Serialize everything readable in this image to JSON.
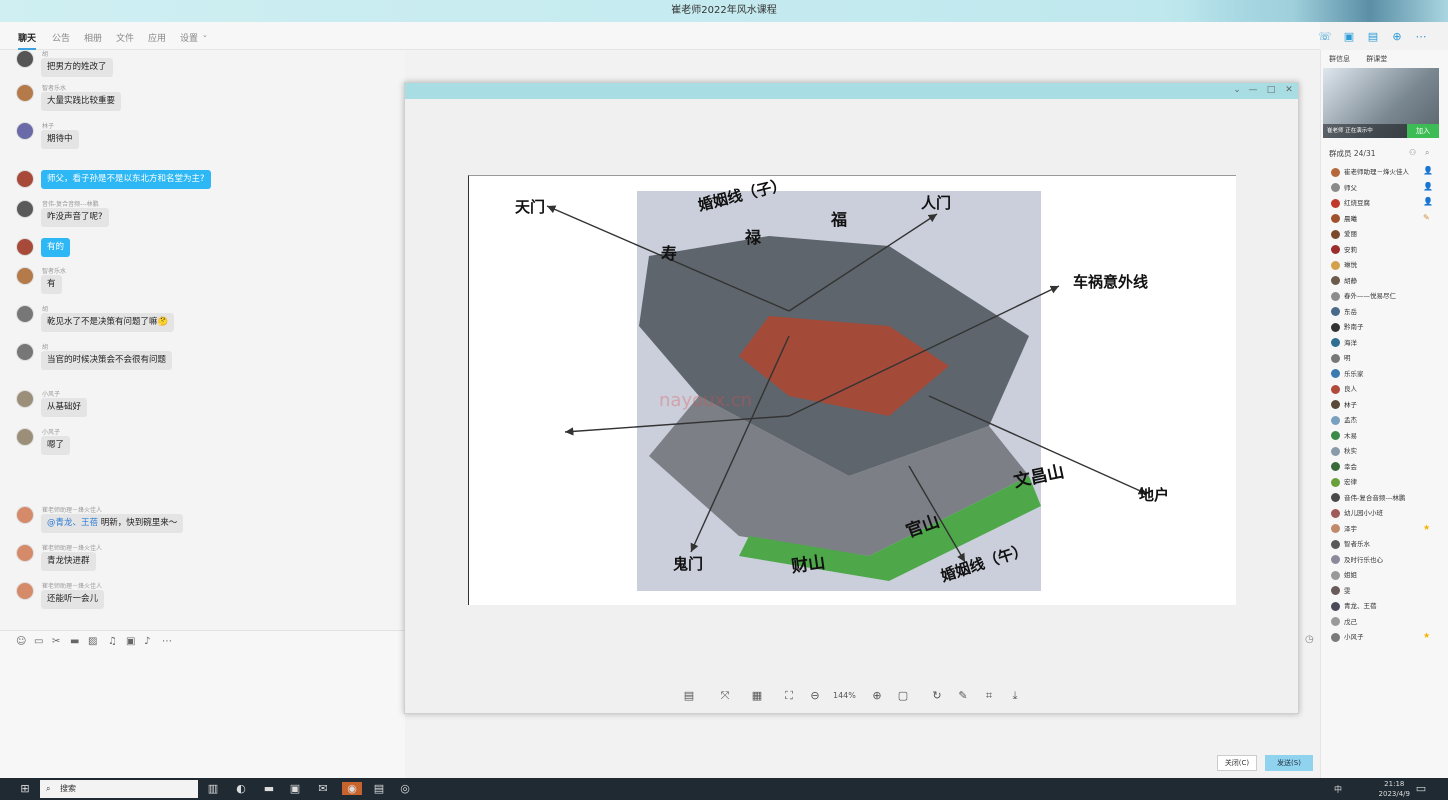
{
  "window": {
    "title": "崔老师2022年风水课程"
  },
  "tabs": [
    {
      "label": "聊天"
    },
    {
      "label": "公告"
    },
    {
      "label": "相册"
    },
    {
      "label": "文件"
    },
    {
      "label": "应用"
    },
    {
      "label": "设置"
    }
  ],
  "chat": {
    "messages": [
      {
        "sender": "胡",
        "text": "把男方的姓改了"
      },
      {
        "sender": "智者乐水",
        "text": "大量实践比较重要"
      },
      {
        "sender": "林子",
        "text": "期待中"
      },
      {
        "sender": "",
        "text": "师父，看子孙是不是以东北方和名堂为主?"
      },
      {
        "sender": "音伟-复合音频---林鹏",
        "text": "咋没声音了呢?"
      },
      {
        "sender": "",
        "text": "有的"
      },
      {
        "sender": "智者乐水",
        "text": "有"
      },
      {
        "sender": "胡",
        "text": "乾见水了不是决策有问题了嘛🤔"
      },
      {
        "sender": "胡",
        "text": "当官的时候决策会不会很有问题"
      },
      {
        "sender": "小风子",
        "text": "从基础好"
      },
      {
        "sender": "小风子",
        "text": "嗯了"
      },
      {
        "sender": "崔老师助理－烽火佳人",
        "mention": "@青龙、王蓓",
        "text": " 明新，快到碗里来～"
      },
      {
        "sender": "崔老师助理－烽火佳人",
        "text": "青龙快进群"
      },
      {
        "sender": "崔老师助理－烽火佳人",
        "text": "还能听一会儿"
      }
    ]
  },
  "viewer": {
    "zoom": "144%",
    "diagram_labels": [
      "天门",
      "婚姻线（子）",
      "寿",
      "禄",
      "福",
      "人门",
      "车祸意外线",
      "文昌山",
      "地户",
      "官山",
      "鬼门",
      "财山",
      "婚姻线（午）"
    ],
    "watermark": "nayoux.cn"
  },
  "right_panel": {
    "tabs": [
      "群信息",
      "群课堂"
    ],
    "live_label": "崔老师 正在演示中",
    "join_label": "加入",
    "member_title": "群成员 24/31",
    "members": [
      {
        "name": "崔老师助理－烽火佳人",
        "badge": "👤"
      },
      {
        "name": "师父",
        "badge": "👤"
      },
      {
        "name": "红烧豆腐",
        "badge": "👤"
      },
      {
        "name": "晨曦",
        "badge": "✎"
      },
      {
        "name": "爱丽",
        "badge": ""
      },
      {
        "name": "安莉",
        "badge": ""
      },
      {
        "name": "琳悦",
        "badge": ""
      },
      {
        "name": "胡静",
        "badge": ""
      },
      {
        "name": "春外——悦易尽仁",
        "badge": ""
      },
      {
        "name": "东岳",
        "badge": ""
      },
      {
        "name": "黔南子",
        "badge": ""
      },
      {
        "name": "海洋",
        "badge": ""
      },
      {
        "name": "明",
        "badge": ""
      },
      {
        "name": "乐乐家",
        "badge": ""
      },
      {
        "name": "良人",
        "badge": ""
      },
      {
        "name": "林子",
        "badge": ""
      },
      {
        "name": "孟杰",
        "badge": ""
      },
      {
        "name": "木易",
        "badge": ""
      },
      {
        "name": "秋实",
        "badge": ""
      },
      {
        "name": "幸会",
        "badge": ""
      },
      {
        "name": "宏律",
        "badge": ""
      },
      {
        "name": "音伟-复合音频---林鹏",
        "badge": ""
      },
      {
        "name": "幼儿园小小班",
        "badge": ""
      },
      {
        "name": "泽宇",
        "badge": "★"
      },
      {
        "name": "智者乐水",
        "badge": ""
      },
      {
        "name": "及时行乐也心",
        "badge": ""
      },
      {
        "name": "姐姐",
        "badge": ""
      },
      {
        "name": "雯",
        "badge": ""
      },
      {
        "name": "青龙、王蓓",
        "badge": ""
      },
      {
        "name": "戊己",
        "badge": ""
      },
      {
        "name": "小风子",
        "badge": "★"
      }
    ]
  },
  "buttons": {
    "close": "关闭(C)",
    "send": "发送(S)"
  },
  "taskbar": {
    "search_placeholder": "搜索",
    "time": "21:18",
    "date": "2023/4/9",
    "ime": "中"
  },
  "colors": {
    "accent": "#2db7f5",
    "title_bg": "#cfeff2",
    "viewer_title": "#a7dde3",
    "join": "#3dbb54"
  }
}
